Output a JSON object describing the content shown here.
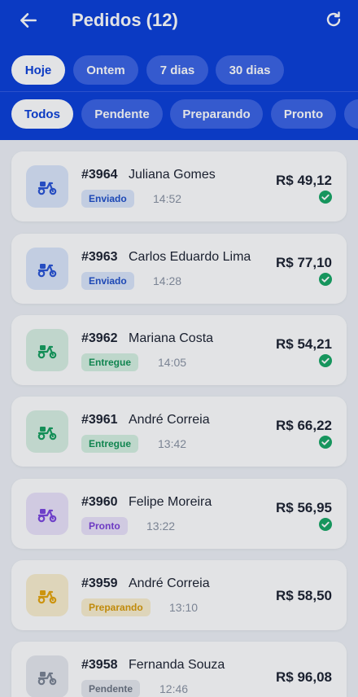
{
  "header": {
    "title": "Pedidos (12)"
  },
  "date_filters": [
    "Hoje",
    "Ontem",
    "7 dias",
    "30 dias"
  ],
  "status_filters": [
    "Todos",
    "Pendente",
    "Preparando",
    "Pronto"
  ],
  "orders": [
    {
      "id": "#3964",
      "customer": "Juliana Gomes",
      "status": "Enviado",
      "time": "14:52",
      "total": "R$ 49,12",
      "paid": true
    },
    {
      "id": "#3963",
      "customer": "Carlos Eduardo Lima",
      "status": "Enviado",
      "time": "14:28",
      "total": "R$ 77,10",
      "paid": true
    },
    {
      "id": "#3962",
      "customer": "Mariana Costa",
      "status": "Entregue",
      "time": "14:05",
      "total": "R$ 54,21",
      "paid": true
    },
    {
      "id": "#3961",
      "customer": "André Correia",
      "status": "Entregue",
      "time": "13:42",
      "total": "R$ 66,22",
      "paid": true
    },
    {
      "id": "#3960",
      "customer": "Felipe Moreira",
      "status": "Pronto",
      "time": "13:22",
      "total": "R$ 56,95",
      "paid": true
    },
    {
      "id": "#3959",
      "customer": "André Correia",
      "status": "Preparando",
      "time": "13:10",
      "total": "R$ 58,50",
      "paid": false
    },
    {
      "id": "#3958",
      "customer": "Fernanda Souza",
      "status": "Pendente",
      "time": "12:46",
      "total": "R$ 96,08",
      "paid": false
    }
  ],
  "colors": {
    "brand": "#0b3fd9",
    "paid_check": "#17a765"
  },
  "icons": {
    "back": "arrow-left-icon",
    "refresh": "refresh-icon",
    "order": "scooter-icon",
    "paid": "check-circle-icon"
  }
}
